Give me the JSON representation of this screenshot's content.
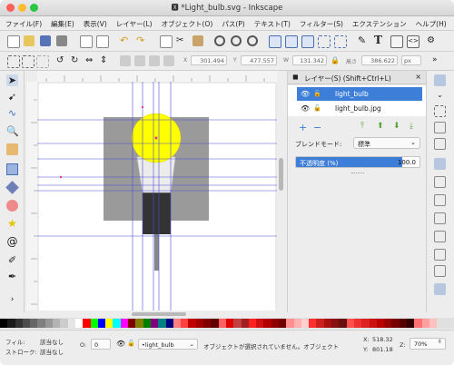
{
  "window": {
    "title": "*Light_bulb.svg - Inkscape",
    "colors": {
      "accent": "#3d7fd8",
      "close": "#ff5f57",
      "minimize": "#febc2e",
      "zoom": "#28c840"
    }
  },
  "menu": [
    "ファイル(F)",
    "編集(E)",
    "表示(V)",
    "レイヤー(L)",
    "オブジェクト(O)",
    "パス(P)",
    "テキスト(T)",
    "フィルター(S)",
    "エクステンション",
    "ヘルプ(H)"
  ],
  "toolbar": {
    "x_label": "X",
    "x_value": "301.494",
    "y_label": "Y",
    "y_value": "477.557",
    "w_label": "W",
    "w_value": "131.342",
    "h_label": "高さ",
    "h_value": "386.622",
    "unit": "px"
  },
  "layers_panel": {
    "title": "レイヤー(S) (Shift+Ctrl+L)",
    "layers": [
      {
        "name": "light_bulb",
        "selected": true
      },
      {
        "name": "light_bulb.jpg",
        "selected": false
      }
    ],
    "blend_label": "ブレンドモード:",
    "blend_value": "標準",
    "opacity_label": "不透明度 (%)",
    "opacity_value": "100.0"
  },
  "statusbar": {
    "fill_label": "フィル:",
    "fill_value": "該当なし",
    "stroke_label": "ストローク:",
    "stroke_value": "該当なし",
    "opacity_label": "O:",
    "opacity_value": "0",
    "layer_value": "•light_bulb",
    "message": "オブジェクトが選択されていません。オブジェクト",
    "x_label": "X:",
    "x_value": "518.32",
    "y_label": "Y:",
    "y_value": "801.18",
    "zoom_label": "Z:",
    "zoom_value": "70%"
  },
  "palette": [
    "#000000",
    "#1a1a1a",
    "#333333",
    "#4d4d4d",
    "#666666",
    "#808080",
    "#999999",
    "#b3b3b3",
    "#cccccc",
    "#e6e6e6",
    "#ffffff",
    "#ff0000",
    "#00ff00",
    "#0000ff",
    "#ffff00",
    "#00ffff",
    "#ff00ff",
    "#800000",
    "#808000",
    "#008000",
    "#800080",
    "#008080",
    "#000080",
    "#ff8080",
    "#ff4040",
    "#c00000",
    "#a00000",
    "#800000",
    "#600000",
    "#ff6060",
    "#e00000",
    "#c04040",
    "#a02020",
    "#ff2020",
    "#d01010",
    "#b00000",
    "#900000",
    "#700000",
    "#ff9090",
    "#ffb0b0",
    "#ffd0d0",
    "#ff3030",
    "#cc2020",
    "#aa1010",
    "#881010",
    "#661010",
    "#ff5050",
    "#ee3030",
    "#dd2020",
    "#cc1010",
    "#bb0000",
    "#990000",
    "#770000",
    "#550000",
    "#330000",
    "#ff7070",
    "#ffa0a0",
    "#ffc0c0"
  ]
}
